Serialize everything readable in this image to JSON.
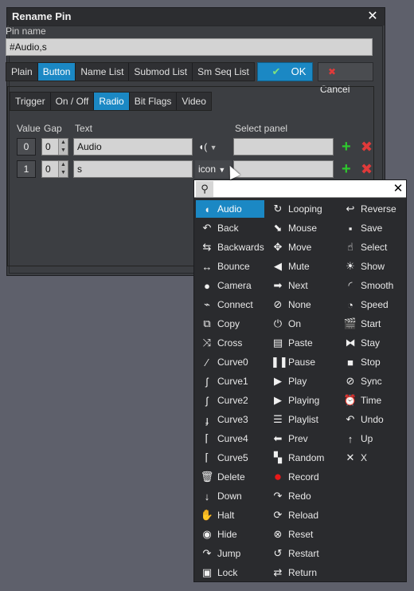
{
  "dialog": {
    "title": "Rename Pin",
    "close_glyph": "✕",
    "pin_name_label": "Pin name",
    "pin_name_value": "#Audio,s",
    "type_tabs": [
      {
        "label": "Plain",
        "active": false
      },
      {
        "label": "Button",
        "active": true
      },
      {
        "label": "Name List",
        "active": false
      },
      {
        "label": "Submod List",
        "active": false
      },
      {
        "label": "Sm Seq List",
        "active": false
      }
    ],
    "ok_label": "OK",
    "cancel_label": "Cancel",
    "mode_tabs": [
      {
        "label": "Trigger",
        "active": false
      },
      {
        "label": "On / Off",
        "active": false
      },
      {
        "label": "Radio",
        "active": true
      },
      {
        "label": "Bit Flags",
        "active": false
      },
      {
        "label": "Video",
        "active": false
      }
    ],
    "headers": {
      "value": "Value",
      "gap": "Gap",
      "text": "Text",
      "select_panel": "Select panel"
    },
    "rows": [
      {
        "value": "0",
        "gap": "0",
        "text": "Audio",
        "icon_label": ""
      },
      {
        "value": "1",
        "gap": "0",
        "text": "s",
        "icon_label": "icon"
      }
    ]
  },
  "icon_picker": {
    "search_placeholder": "",
    "search_value": "",
    "columns": [
      [
        {
          "label": "Audio",
          "icon": "audio-icon",
          "glyph": "◖",
          "selected": true
        },
        {
          "label": "Back",
          "icon": "back-icon",
          "glyph": "↶"
        },
        {
          "label": "Backwards",
          "icon": "backwards-icon",
          "glyph": "⇆"
        },
        {
          "label": "Bounce",
          "icon": "bounce-icon",
          "glyph": "↔"
        },
        {
          "label": "Camera",
          "icon": "camera-icon",
          "glyph": "●"
        },
        {
          "label": "Connect",
          "icon": "connect-icon",
          "glyph": "⌁"
        },
        {
          "label": "Copy",
          "icon": "copy-icon",
          "glyph": "⧉"
        },
        {
          "label": "Cross",
          "icon": "cross-icon",
          "glyph": "⤨"
        },
        {
          "label": "Curve0",
          "icon": "curve0-icon",
          "glyph": "⁄"
        },
        {
          "label": "Curve1",
          "icon": "curve1-icon",
          "glyph": "ʃ"
        },
        {
          "label": "Curve2",
          "icon": "curve2-icon",
          "glyph": "ʃ"
        },
        {
          "label": "Curve3",
          "icon": "curve3-icon",
          "glyph": "ɟ"
        },
        {
          "label": "Curve4",
          "icon": "curve4-icon",
          "glyph": "⌈"
        },
        {
          "label": "Curve5",
          "icon": "curve5-icon",
          "glyph": "⌈"
        },
        {
          "label": "Delete",
          "icon": "delete-icon",
          "glyph": "🗑"
        },
        {
          "label": "Down",
          "icon": "down-icon",
          "glyph": "↓"
        },
        {
          "label": "Halt",
          "icon": "halt-icon",
          "glyph": "✋"
        },
        {
          "label": "Hide",
          "icon": "hide-icon",
          "glyph": "◉"
        },
        {
          "label": "Jump",
          "icon": "jump-icon",
          "glyph": "↷"
        },
        {
          "label": "Lock",
          "icon": "lock-icon",
          "glyph": "▣"
        }
      ],
      [
        {
          "label": "Looping",
          "icon": "looping-icon",
          "glyph": "↻"
        },
        {
          "label": "Mouse",
          "icon": "mouse-icon",
          "glyph": "⬊"
        },
        {
          "label": "Move",
          "icon": "move-icon",
          "glyph": "✥"
        },
        {
          "label": "Mute",
          "icon": "mute-icon",
          "glyph": "◀"
        },
        {
          "label": "Next",
          "icon": "next-icon",
          "glyph": "➡"
        },
        {
          "label": "None",
          "icon": "none-icon",
          "glyph": "⊘"
        },
        {
          "label": "On",
          "icon": "power-icon",
          "glyph": "⏻"
        },
        {
          "label": "Paste",
          "icon": "paste-icon",
          "glyph": "▤"
        },
        {
          "label": "Pause",
          "icon": "pause-icon",
          "glyph": "❚❚"
        },
        {
          "label": "Play",
          "icon": "play-icon",
          "glyph": "▶"
        },
        {
          "label": "Playing",
          "icon": "playing-icon",
          "glyph": "▶"
        },
        {
          "label": "Playlist",
          "icon": "playlist-icon",
          "glyph": "☰"
        },
        {
          "label": "Prev",
          "icon": "prev-icon",
          "glyph": "⬅"
        },
        {
          "label": "Random",
          "icon": "random-icon",
          "glyph": "▚"
        },
        {
          "label": "Record",
          "icon": "record-icon",
          "glyph": "●",
          "color": "#e81818"
        },
        {
          "label": "Redo",
          "icon": "redo-icon",
          "glyph": "↷"
        },
        {
          "label": "Reload",
          "icon": "reload-icon",
          "glyph": "⟳"
        },
        {
          "label": "Reset",
          "icon": "reset-icon",
          "glyph": "⊗"
        },
        {
          "label": "Restart",
          "icon": "restart-icon",
          "glyph": "↺"
        },
        {
          "label": "Return",
          "icon": "return-icon",
          "glyph": "⇄"
        }
      ],
      [
        {
          "label": "Reverse",
          "icon": "reverse-icon",
          "glyph": "↩"
        },
        {
          "label": "Save",
          "icon": "save-icon",
          "glyph": "▪"
        },
        {
          "label": "Select",
          "icon": "select-icon",
          "glyph": "☝"
        },
        {
          "label": "Show",
          "icon": "show-icon",
          "glyph": "☀"
        },
        {
          "label": "Smooth",
          "icon": "smooth-icon",
          "glyph": "◜"
        },
        {
          "label": "Speed",
          "icon": "speed-icon",
          "glyph": "◔"
        },
        {
          "label": "Start",
          "icon": "start-icon",
          "glyph": "🎬"
        },
        {
          "label": "Stay",
          "icon": "stay-icon",
          "glyph": "⧓"
        },
        {
          "label": "Stop",
          "icon": "stop-icon",
          "glyph": "■"
        },
        {
          "label": "Sync",
          "icon": "sync-icon",
          "glyph": "⊘"
        },
        {
          "label": "Time",
          "icon": "time-icon",
          "glyph": "⏰"
        },
        {
          "label": "Undo",
          "icon": "undo-icon",
          "glyph": "↶"
        },
        {
          "label": "Up",
          "icon": "up-icon",
          "glyph": "↑"
        },
        {
          "label": "X",
          "icon": "x-icon",
          "glyph": "✕"
        }
      ]
    ]
  },
  "colors": {
    "accent": "#1b88c4",
    "add": "#2ec72e",
    "remove": "#e03a3a",
    "record": "#e81818"
  }
}
